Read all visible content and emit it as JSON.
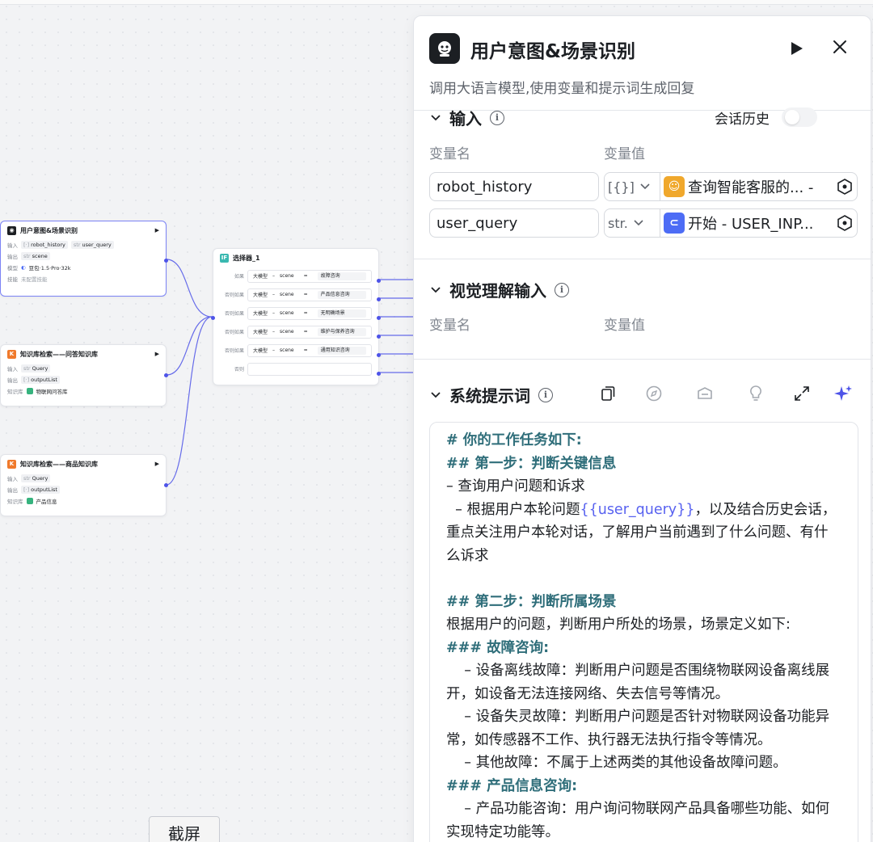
{
  "nodes": {
    "intent": {
      "title": "用户意图&场景识别",
      "input_label": "输入",
      "input_tags": [
        {
          "type": "[·]",
          "name": "robot_history"
        },
        {
          "type": "str",
          "name": "user_query"
        }
      ],
      "output_label": "输出",
      "output_tags": [
        {
          "type": "str",
          "name": "scene"
        }
      ],
      "model_label": "模型",
      "model_value": "豆包·1.5·Pro·32k",
      "skill_label": "技能",
      "skill_value": "未配置技能"
    },
    "selector": {
      "title": "选择器_1",
      "rows": [
        {
          "label": "如果",
          "left": "大模型",
          "op1": "scene",
          "op2": "=",
          "value": "故障咨询"
        },
        {
          "label": "否则如果",
          "left": "大模型",
          "op1": "scene",
          "op2": "=",
          "value": "产品信息咨询"
        },
        {
          "label": "否则如果",
          "left": "大模型",
          "op1": "scene",
          "op2": "=",
          "value": "无明确场景"
        },
        {
          "label": "否则如果",
          "left": "大模型",
          "op1": "scene",
          "op2": "=",
          "value": "维护与保养咨询"
        },
        {
          "label": "否则如果",
          "left": "大模型",
          "op1": "scene",
          "op2": "=",
          "value": "通用知识咨询"
        }
      ],
      "else_label": "否则"
    },
    "kb_qa": {
      "title": "知识库检索——问答知识库",
      "input_label": "输入",
      "input_tag": {
        "type": "str",
        "name": "Query"
      },
      "output_label": "输出",
      "output_tag": {
        "type": "[·]",
        "name": "outputList"
      },
      "kb_label": "知识库",
      "kb_value": "物联网问答库"
    },
    "kb_product": {
      "title": "知识库检索——商品知识库",
      "input_label": "输入",
      "input_tag": {
        "type": "str",
        "name": "Query"
      },
      "output_label": "输出",
      "output_tag": {
        "type": "[·]",
        "name": "outputList"
      },
      "kb_label": "知识库",
      "kb_value": "产品信息"
    }
  },
  "panel": {
    "title": "用户意图&场景识别",
    "description": "调用大语言模型,使用变量和提示词生成回复",
    "input_section": {
      "title": "输入",
      "history_label": "会话历史",
      "col_name": "变量名",
      "col_value": "变量值",
      "rows": [
        {
          "name": "robot_history",
          "type": "[{}]",
          "ref": "查询智能客服的... -",
          "ref_color": "#f0a82c"
        },
        {
          "name": "user_query",
          "type": "str.",
          "ref": "开始 - USER_INP...",
          "ref_color": "#4d6cf5"
        }
      ]
    },
    "vision_section": {
      "title": "视觉理解输入",
      "col_name": "变量名",
      "col_value": "变量值"
    },
    "prompt_section": {
      "title": "系统提示词",
      "lines": [
        {
          "kind": "h",
          "text": "# 你的工作任务如下:"
        },
        {
          "kind": "h",
          "text": "## 第一步：判断关键信息"
        },
        {
          "kind": "t",
          "text": "– 查询用户问题和诉求"
        },
        {
          "kind": "var",
          "pre": "  – 根据用户本轮问题",
          "var": "{{user_query}}",
          "post": "，以及结合历史会话，重点关注用户本轮对话，了解用户当前遇到了什么问题、有什么诉求"
        },
        {
          "kind": "blank",
          "text": ""
        },
        {
          "kind": "h",
          "text": "## 第二步：判断所属场景"
        },
        {
          "kind": "t",
          "text": "根据用户的问题，判断用户所处的场景，场景定义如下:"
        },
        {
          "kind": "h",
          "text": "### 故障咨询:"
        },
        {
          "kind": "t",
          "text": "    – 设备离线故障：判断用户问题是否围绕物联网设备离线展开，如设备无法连接网络、失去信号等情况。"
        },
        {
          "kind": "t",
          "text": "    – 设备失灵故障：判断用户问题是否针对物联网设备功能异常，如传感器不工作、执行器无法执行指令等情况。"
        },
        {
          "kind": "t",
          "text": "    – 其他故障：不属于上述两类的其他设备故障问题。"
        },
        {
          "kind": "h",
          "text": "### 产品信息咨询:"
        },
        {
          "kind": "t",
          "text": "    – 产品功能咨询：用户询问物联网产品具备哪些功能、如何实现特定功能等。"
        }
      ]
    }
  },
  "screenshot_button": "截屏",
  "colors": {
    "accent": "#4d53e8",
    "heading": "#2f6e7a",
    "variable": "#5862f0"
  }
}
